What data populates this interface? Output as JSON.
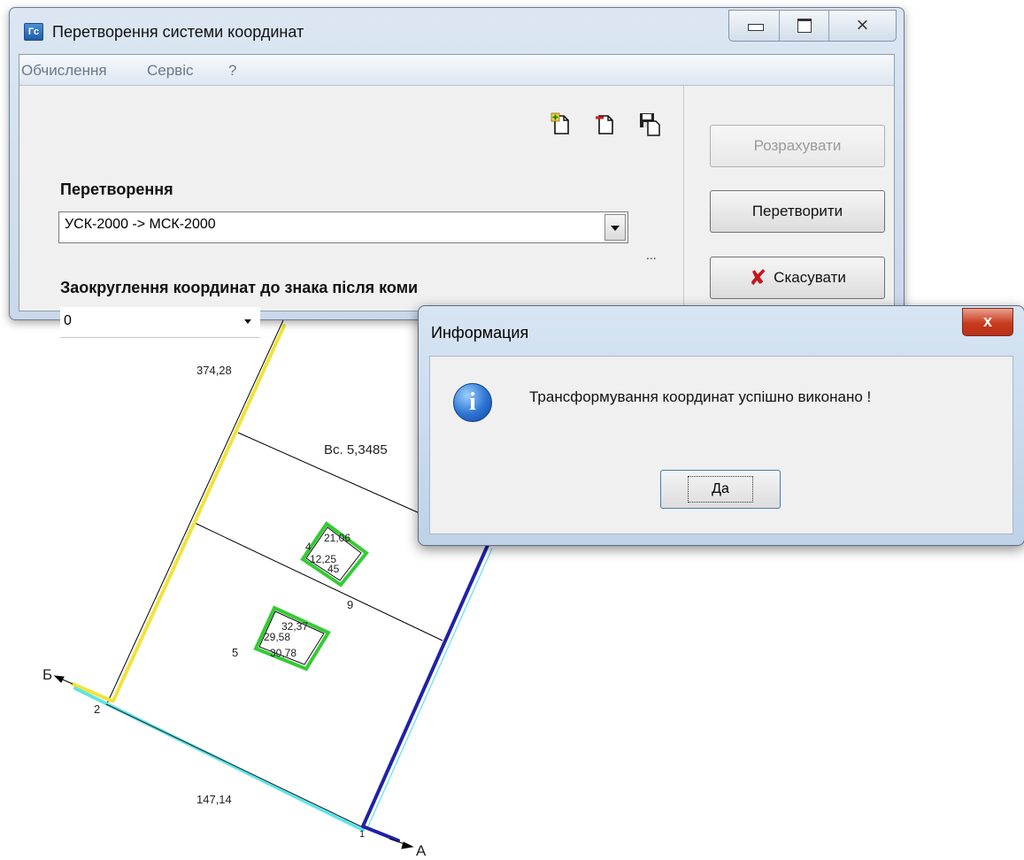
{
  "map": {
    "labels": {
      "len_left": "374,28",
      "area": "Вс. 5,3485",
      "len_bottom": "147,14",
      "corner_b": "Б",
      "corner_a": "А",
      "pt_2": "2",
      "pt_1": "1",
      "pt_5": "5",
      "pt_9": "9",
      "plot1_a": "21,06",
      "plot1_b": "4",
      "plot1_c": "12,25",
      "plot1_d": "45",
      "plot2_a": "32,37",
      "plot2_b": "29,58",
      "plot2_c": "30,78"
    },
    "colors": {
      "yellow_boundary": "#f2e33b",
      "cyan_boundary": "#5fe3e8",
      "blue_boundary": "#1f22a8",
      "green_plot": "#33cc33"
    }
  },
  "main_window": {
    "title": "Перетворення системи координат",
    "menu": [
      "Обчислення",
      "Сервіс",
      "?"
    ],
    "transform_label": "Перетворення",
    "transform_value": "УСК-2000 -> МСК-2000",
    "ellipsis": "...",
    "rounding_label": "Заокруглення координат до знака після коми",
    "rounding_value": "0",
    "buttons": {
      "calculate": "Розрахувати",
      "convert": "Перетворити",
      "cancel": "Скасувати"
    },
    "icons": [
      "add-file-icon",
      "remove-file-icon",
      "save-icon"
    ]
  },
  "dialog": {
    "title": "Информация",
    "message": "Трансформування координат успішно виконано !",
    "ok_label": "Да",
    "close": "x"
  }
}
